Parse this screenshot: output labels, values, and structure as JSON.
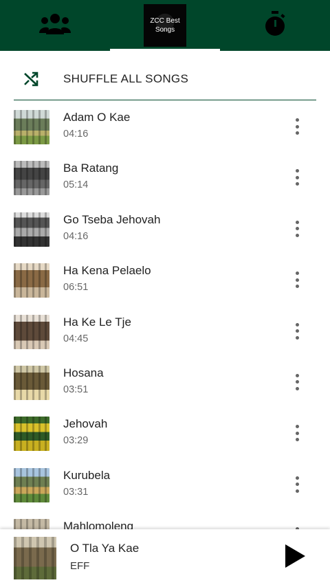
{
  "tabs": [
    {
      "name": "artists",
      "icon": "group-icon"
    },
    {
      "name": "playlist",
      "logo_text": "ZCC Best Songs",
      "selected": true
    },
    {
      "name": "sleep-timer",
      "icon": "stopwatch-icon"
    }
  ],
  "logo": {
    "line1": "ZCC Best",
    "line2": "Songs"
  },
  "shuffle": {
    "label": "SHUFFLE ALL SONGS",
    "icon": "shuffle-icon"
  },
  "songs": [
    {
      "title": "Adam O Kae",
      "duration": "04:16"
    },
    {
      "title": "Ba Ratang",
      "duration": "05:14"
    },
    {
      "title": "Go Tseba Jehovah",
      "duration": "04:16"
    },
    {
      "title": "Ha Kena Pelaelo",
      "duration": "06:51"
    },
    {
      "title": "Ha Ke Le Tje",
      "duration": "04:45"
    },
    {
      "title": "Hosana",
      "duration": "03:51"
    },
    {
      "title": "Jehovah",
      "duration": "03:29"
    },
    {
      "title": "Kurubela",
      "duration": "03:31"
    },
    {
      "title": "Mahlomoleng",
      "duration": ""
    }
  ],
  "now_playing": {
    "title": "O Tla Ya Kae",
    "artist": "EFF"
  },
  "colors": {
    "header": "#00462a",
    "indicator": "#ffffff",
    "text": "#222222",
    "secondary": "#666666"
  }
}
